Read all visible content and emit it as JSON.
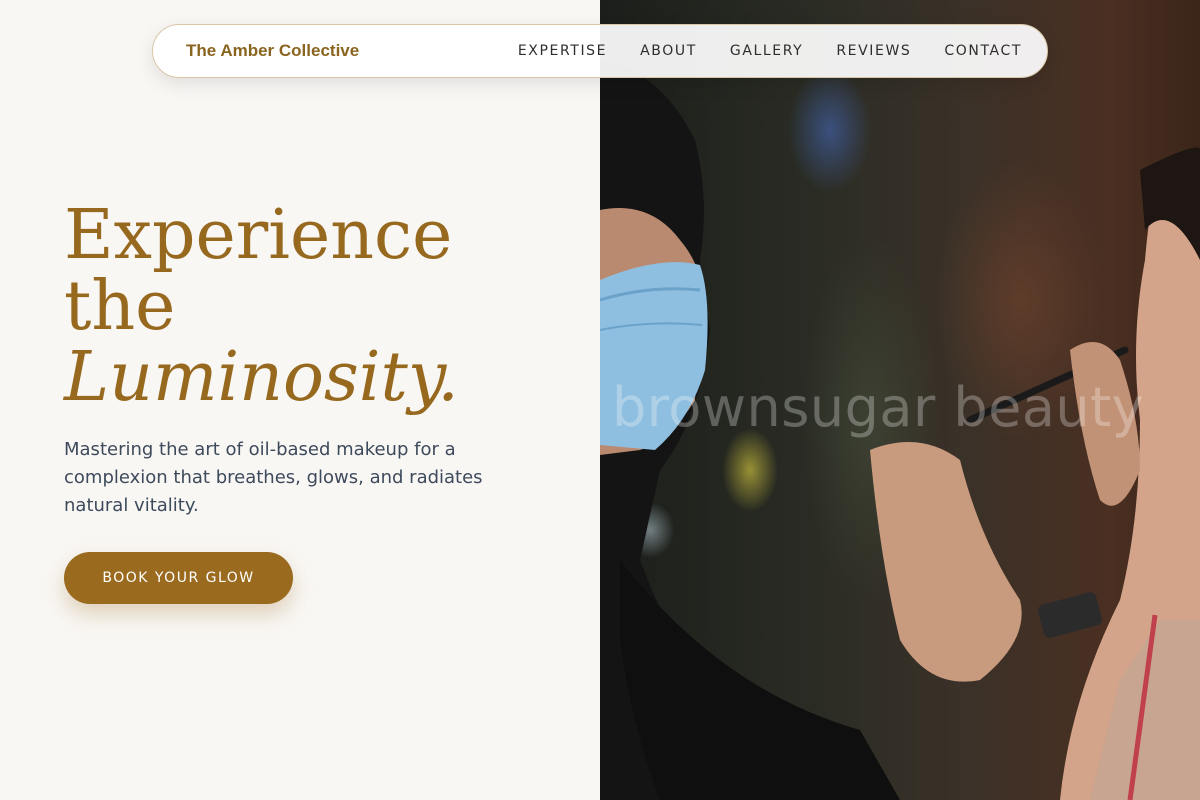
{
  "nav": {
    "brand": "The Amber Collective",
    "links": [
      "EXPERTISE",
      "ABOUT",
      "GALLERY",
      "REVIEWS",
      "CONTACT"
    ]
  },
  "hero": {
    "title_lines": [
      "Experience",
      "the",
      "Luminosity."
    ],
    "subtitle": "Mastering the art of oil-based makeup for a complexion that breathes, glows, and radiates natural vitality.",
    "cta_label": "BOOK YOUR GLOW"
  },
  "photo": {
    "watermark": "brownsugar beauty"
  },
  "colors": {
    "accent": "#97691f",
    "button": "#9a6a1f",
    "background": "#f9f7f4",
    "body_text": "#3d4a5c"
  }
}
